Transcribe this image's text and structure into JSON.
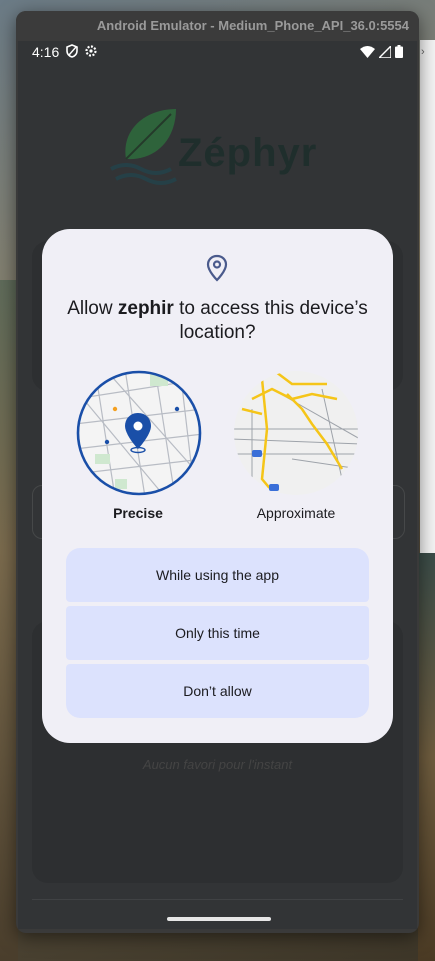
{
  "window": {
    "title": "Android Emulator - Medium_Phone_API_36.0:5554"
  },
  "status_bar": {
    "time": "4:16"
  },
  "app": {
    "logo_text": "Zéphyr",
    "empty_favorites": "Aucun favori pour l'instant"
  },
  "dialog": {
    "title_prefix": "Allow ",
    "app_name": "zephir",
    "title_suffix": " to access this device’s location?",
    "precise_label": "Precise",
    "approximate_label": "Approximate",
    "buttons": {
      "while_using": "While using the app",
      "only_this_time": "Only this time",
      "dont_allow": "Don’t allow"
    }
  },
  "colors": {
    "dialog_bg": "#f0eff6",
    "button_bg": "#dce2fd",
    "accent": "#1a4fa8",
    "map_road": "#f5c518"
  },
  "side_panel": {
    "glyph": "›"
  }
}
